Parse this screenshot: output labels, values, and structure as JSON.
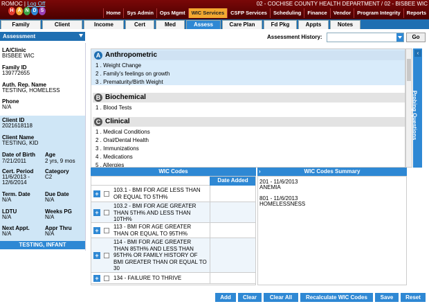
{
  "header": {
    "user": "ROMOC",
    "logout": "Log Off",
    "logo_letters": [
      "H",
      "A",
      "N",
      "D",
      "S"
    ],
    "department": "02 - COCHISE COUNTY HEALTH DEPARTMENT / 02 - BISBEE WIC",
    "nav": [
      "Home",
      "Sys Admin",
      "Ops Mgmt",
      "WIC Services",
      "CSFP Services",
      "Scheduling",
      "Finance",
      "Vendor",
      "Program Integrity",
      "Reports"
    ],
    "active_nav": "WIC Services"
  },
  "tabs": [
    "Family",
    "Client",
    "Income",
    "Cert",
    "Med",
    "Assess",
    "Care Plan",
    "Fd Pkg",
    "Appts",
    "Notes"
  ],
  "active_tab": "Assess",
  "toolbar": {
    "assessment_label": "Assessment",
    "history_label": "Assessment History:",
    "history_value": "",
    "go_label": "Go"
  },
  "sidebar": {
    "la_clinic_label": "LA/Clinic",
    "la_clinic_value": "BISBEE WIC",
    "family_id_label": "Family ID",
    "family_id_value": "139772655",
    "auth_rep_label": "Auth. Rep. Name",
    "auth_rep_value": "TESTING, HOMELESS",
    "phone_label": "Phone",
    "phone_value": "N/A",
    "client_id_label": "Client ID",
    "client_id_value": "2021618118",
    "client_name_label": "Client Name",
    "client_name_value": "TESTING, KID",
    "dob_label": "Date of Birth",
    "dob_value": "7/21/2011",
    "age_label": "Age",
    "age_value": "2 yrs, 9 mos",
    "cert_period_label": "Cert. Period",
    "cert_period_value1": "11/6/2013 -",
    "cert_period_value2": "12/6/2014",
    "category_label": "Category",
    "category_value": "C2",
    "term_date_label": "Term. Date",
    "term_date_value": "N/A",
    "due_date_label": "Due Date",
    "due_date_value": "N/A",
    "ldtu_label": "LDTU",
    "ldtu_value": "N/A",
    "weeks_pg_label": "Weeks PG",
    "weeks_pg_value": "N/A",
    "next_appt_label": "Next Appt.",
    "next_appt_value": "N/A",
    "appr_thru_label": "Appr Thru",
    "appr_thru_value": "N/A",
    "client_type": "TESTING, INFANT"
  },
  "categories": [
    {
      "letter": "A",
      "title": "Anthropometric",
      "items": [
        "1 . Weight Change",
        "2 . Family's feelings on growth",
        "3 . Prematurity/Birth Weight"
      ]
    },
    {
      "letter": "B",
      "title": "Biochemical",
      "items": [
        "1 . Blood Tests"
      ]
    },
    {
      "letter": "C",
      "title": "Clinical",
      "items": [
        "1 . Medical Conditions",
        "2 . Oral/Dental Health",
        "3 . Immunizations",
        "4 . Medications",
        "5 . Allergies"
      ]
    }
  ],
  "probing_label": "Probing Questions",
  "wic_codes": {
    "header": "WIC Codes",
    "date_added_label": "Date Added",
    "rows": [
      "103.1 - BMI FOR AGE LESS THAN OR EQUAL TO 5TH%",
      "103.2 - BMI FOR AGE GREATER THAN 5TH% AND LESS THAN 10TH%",
      "113 - BMI FOR AGE GREATER THAN OR EQUAL TO 95TH%",
      "114 - BMI FOR AGE GREATER THAN 85TH% AND LESS THAN 95TH% OR FAMILY HISTORY OF BMI GREATER THAN OR EQUAL TO 30",
      "134 - FAILURE TO THRIVE"
    ]
  },
  "summary": {
    "header": "WIC Codes Summary",
    "entries": [
      {
        "code": "201 - 11/6/2013",
        "desc": "ANEMIA"
      },
      {
        "code": "801 - 11/6/2013",
        "desc": "HOMELESSNESS"
      }
    ]
  },
  "buttons": [
    "Add",
    "Clear",
    "Clear All",
    "Recalculate WIC Codes",
    "Save",
    "Reset"
  ],
  "colors": {
    "header_bg": "#6a0303",
    "accent": "#2e88d4",
    "active_nav": "#f3a830"
  }
}
